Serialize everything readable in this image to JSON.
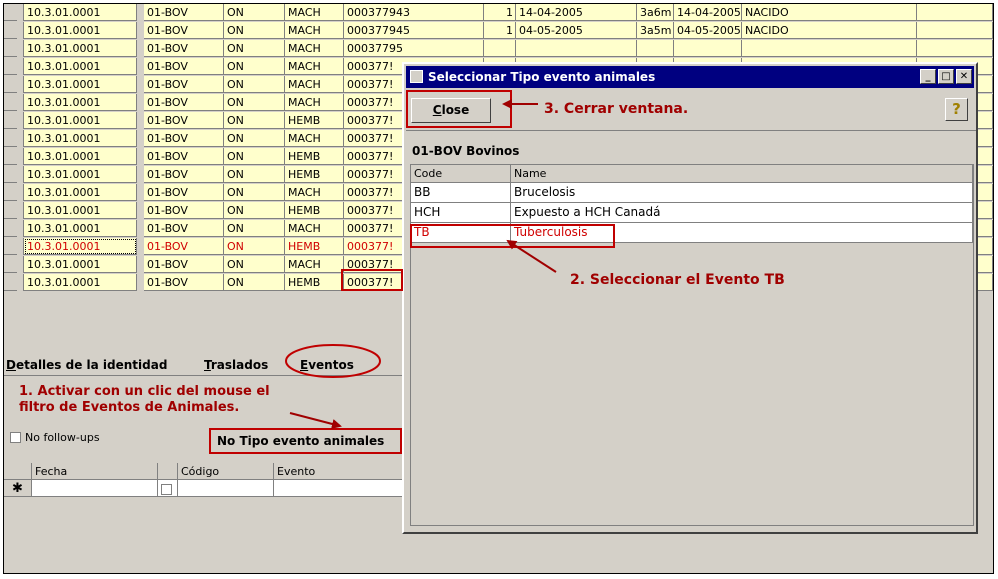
{
  "grid_rows": [
    {
      "code": "10.3.01.0001",
      "species": "01-BOV",
      "status": "ON",
      "sex": "MACH",
      "id": "000377943",
      "n": "1",
      "date1": "14-04-2005",
      "age": "3a6m",
      "date2": "14-04-2005",
      "origin": "NACIDO",
      "selected": false
    },
    {
      "code": "10.3.01.0001",
      "species": "01-BOV",
      "status": "ON",
      "sex": "MACH",
      "id": "000377945",
      "n": "1",
      "date1": "04-05-2005",
      "age": "3a5m",
      "date2": "04-05-2005",
      "origin": "NACIDO",
      "selected": false
    },
    {
      "code": "10.3.01.0001",
      "species": "01-BOV",
      "status": "ON",
      "sex": "MACH",
      "id": "00037795",
      "n": "",
      "date1": "",
      "age": "",
      "date2": "",
      "origin": "",
      "selected": false
    },
    {
      "code": "10.3.01.0001",
      "species": "01-BOV",
      "status": "ON",
      "sex": "MACH",
      "id": "000377!",
      "n": "",
      "date1": "",
      "age": "",
      "date2": "",
      "origin": "",
      "selected": false
    },
    {
      "code": "10.3.01.0001",
      "species": "01-BOV",
      "status": "ON",
      "sex": "MACH",
      "id": "000377!",
      "n": "",
      "date1": "",
      "age": "",
      "date2": "",
      "origin": "",
      "selected": false
    },
    {
      "code": "10.3.01.0001",
      "species": "01-BOV",
      "status": "ON",
      "sex": "MACH",
      "id": "000377!",
      "n": "",
      "date1": "",
      "age": "",
      "date2": "",
      "origin": "",
      "selected": false
    },
    {
      "code": "10.3.01.0001",
      "species": "01-BOV",
      "status": "ON",
      "sex": "HEMB",
      "id": "000377!",
      "n": "",
      "date1": "",
      "age": "",
      "date2": "",
      "origin": "",
      "selected": false
    },
    {
      "code": "10.3.01.0001",
      "species": "01-BOV",
      "status": "ON",
      "sex": "MACH",
      "id": "000377!",
      "n": "",
      "date1": "",
      "age": "",
      "date2": "",
      "origin": "",
      "selected": false
    },
    {
      "code": "10.3.01.0001",
      "species": "01-BOV",
      "status": "ON",
      "sex": "HEMB",
      "id": "000377!",
      "n": "",
      "date1": "",
      "age": "",
      "date2": "",
      "origin": "",
      "selected": false
    },
    {
      "code": "10.3.01.0001",
      "species": "01-BOV",
      "status": "ON",
      "sex": "HEMB",
      "id": "000377!",
      "n": "",
      "date1": "",
      "age": "",
      "date2": "",
      "origin": "",
      "selected": false
    },
    {
      "code": "10.3.01.0001",
      "species": "01-BOV",
      "status": "ON",
      "sex": "MACH",
      "id": "000377!",
      "n": "",
      "date1": "",
      "age": "",
      "date2": "",
      "origin": "",
      "selected": false
    },
    {
      "code": "10.3.01.0001",
      "species": "01-BOV",
      "status": "ON",
      "sex": "HEMB",
      "id": "000377!",
      "n": "",
      "date1": "",
      "age": "",
      "date2": "",
      "origin": "",
      "selected": false
    },
    {
      "code": "10.3.01.0001",
      "species": "01-BOV",
      "status": "ON",
      "sex": "MACH",
      "id": "000377!",
      "n": "",
      "date1": "",
      "age": "",
      "date2": "",
      "origin": "",
      "selected": false
    },
    {
      "code": "10.3.01.0001",
      "species": "01-BOV",
      "status": "ON",
      "sex": "HEMB",
      "id": "000377!",
      "n": "",
      "date1": "",
      "age": "",
      "date2": "",
      "origin": "",
      "selected": true
    },
    {
      "code": "10.3.01.0001",
      "species": "01-BOV",
      "status": "ON",
      "sex": "MACH",
      "id": "000377!",
      "n": "",
      "date1": "",
      "age": "",
      "date2": "",
      "origin": "",
      "selected": false
    },
    {
      "code": "10.3.01.0001",
      "species": "01-BOV",
      "status": "ON",
      "sex": "HEMB",
      "id": "000377!",
      "n": "",
      "date1": "",
      "age": "",
      "date2": "",
      "origin": "",
      "selected": false
    }
  ],
  "tabs": {
    "details": "etalles de la identidad",
    "details_prefix": "D",
    "moves_underline": "T",
    "moves": "raslados",
    "events_underline": "E",
    "events": "ventos"
  },
  "annotations": {
    "note1_line1": "1. Activar con un clic del mouse el",
    "note1_line2": "filtro de Eventos de Animales.",
    "note2": "2. Seleccionar el Evento TB",
    "note3": "3. Cerrar ventana."
  },
  "filters": {
    "no_followups": "No follow-ups",
    "no_event_type": "No Tipo evento animales"
  },
  "events_grid": {
    "headers": [
      "Fecha",
      "Código",
      "Evento"
    ],
    "new_row_marker": "✱"
  },
  "dialog": {
    "title": "Seleccionar Tipo evento animales",
    "close_label": "Close",
    "close_underline": "C",
    "help_glyph": "?",
    "group_label": "01-BOV Bovinos",
    "columns": [
      "Code",
      "Name"
    ],
    "rows": [
      {
        "code": "BB",
        "name": "Brucelosis",
        "highlight": false
      },
      {
        "code": "HCH",
        "name": "Expuesto a HCH Canadá",
        "highlight": false
      },
      {
        "code": "TB",
        "name": "Tuberculosis",
        "highlight": true
      }
    ],
    "min_glyph": "_",
    "max_glyph": "□",
    "close_glyph": "✕"
  },
  "colors": {
    "annotation": "#c00000",
    "row_bg": "#ffffcc",
    "titlebar": "#000080"
  }
}
